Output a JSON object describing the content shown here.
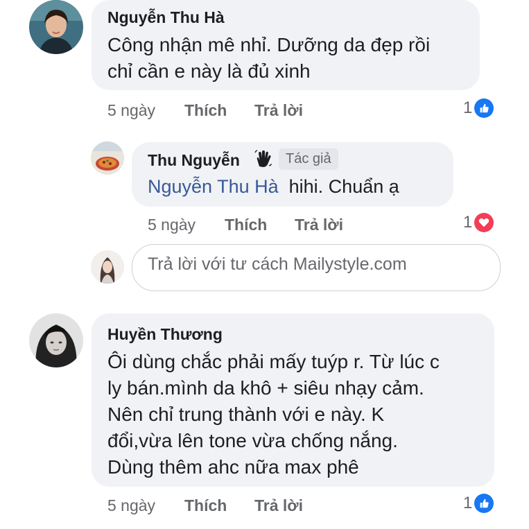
{
  "comments": [
    {
      "author": "Nguyễn Thu Hà",
      "lines": [
        "Công nhận mê nhỉ. Dưỡng da đẹp rồi",
        "chỉ cần e này là đủ xinh"
      ],
      "time": "5 ngày",
      "like_label": "Thích",
      "reply_label": "Trả lời",
      "reaction_count": "1",
      "reaction_icon": "like-icon"
    },
    {
      "author": "Huyền Thương",
      "lines": [
        "Ôi dùng chắc phải mấy tuýp r. Từ lúc c",
        "ly bán.mình da khô + siêu nhạy cảm.",
        "Nên chỉ trung thành với e này. K",
        "đổi,vừa lên tone vừa chống nắng.",
        "Dùng thêm ahc nữa max phê"
      ],
      "time": "5 ngày",
      "like_label": "Thích",
      "reply_label": "Trả lời",
      "reaction_count": "1",
      "reaction_icon": "like-icon"
    }
  ],
  "reply": {
    "author": "Thu Nguyễn",
    "author_icon": "wave-hand-icon",
    "badge": "Tác giả",
    "mention": "Nguyễn Thu Hà",
    "text": "hihi. Chuẩn ạ",
    "time": "5 ngày",
    "like_label": "Thích",
    "reply_label": "Trả lời",
    "reaction_count": "1",
    "reaction_icon": "love-icon"
  },
  "reply_box": {
    "placeholder": "Trả lời với tư cách Mailystyle.com"
  },
  "colors": {
    "bubble": "#f0f2f5",
    "like_blue": "#1877f2",
    "love_red": "#f33e58",
    "mention": "#385898",
    "meta_gray": "#65676b"
  }
}
